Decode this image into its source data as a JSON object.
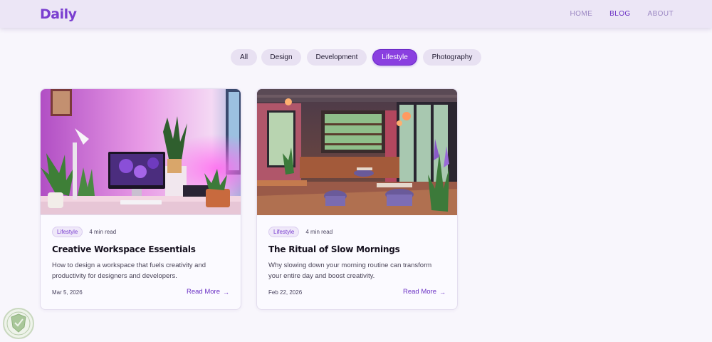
{
  "header": {
    "logo": "Daily",
    "nav": [
      {
        "label": "HOME"
      },
      {
        "label": "BLOG"
      },
      {
        "label": "ABOUT"
      }
    ]
  },
  "filters": [
    "All",
    "Design",
    "Development",
    "Lifestyle",
    "Photography"
  ],
  "active_filter": "Lifestyle",
  "posts": [
    {
      "tag": "Lifestyle",
      "read_time": "4 min read",
      "title": "Creative Workspace Essentials",
      "excerpt": "How to design a workspace that fuels creativity and productivity for designers and developers.",
      "date": "Mar 5, 2026",
      "read_more": "Read More",
      "image_icon": "workspace-photo"
    },
    {
      "tag": "Lifestyle",
      "read_time": "4 min read",
      "title": "The Ritual of Slow Mornings",
      "excerpt": "Why slowing down your morning routine can transform your entire day and boost creativity.",
      "date": "Feb 22, 2026",
      "read_more": "Read More",
      "image_icon": "cafe-photo"
    }
  ],
  "colors": {
    "accent": "#8a3fe0",
    "nav_bg": "#ece6f6",
    "page_bg": "#f8f6fc"
  }
}
